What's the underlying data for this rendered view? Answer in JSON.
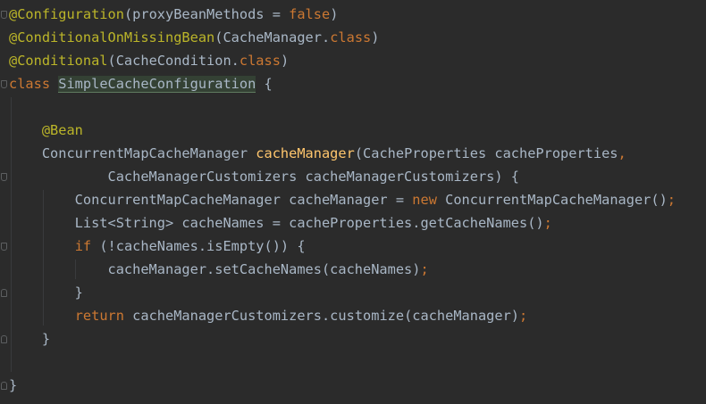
{
  "editor": {
    "lines": [
      [
        [
          "ann",
          "@Configuration"
        ],
        [
          "plain",
          "(proxyBeanMethods = "
        ],
        [
          "kw",
          "false"
        ],
        [
          "plain",
          ")"
        ]
      ],
      [
        [
          "ann",
          "@ConditionalOnMissingBean"
        ],
        [
          "plain",
          "(CacheManager."
        ],
        [
          "kw",
          "class"
        ],
        [
          "plain",
          ")"
        ]
      ],
      [
        [
          "ann",
          "@Conditional"
        ],
        [
          "plain",
          "(CacheCondition."
        ],
        [
          "kw",
          "class"
        ],
        [
          "plain",
          ")"
        ]
      ],
      [
        [
          "kw",
          "class "
        ],
        [
          "hl",
          "SimpleCacheConfiguration"
        ],
        [
          "plain",
          " {"
        ]
      ],
      [],
      [
        [
          "plain",
          "    "
        ],
        [
          "ann",
          "@Bean"
        ]
      ],
      [
        [
          "plain",
          "    ConcurrentMapCacheManager "
        ],
        [
          "fn",
          "cacheManager"
        ],
        [
          "plain",
          "(CacheProperties cacheProperties"
        ],
        [
          "punc",
          ","
        ]
      ],
      [
        [
          "plain",
          "            CacheManagerCustomizers cacheManagerCustomizers) {"
        ]
      ],
      [
        [
          "plain",
          "        ConcurrentMapCacheManager cacheManager = "
        ],
        [
          "kw",
          "new "
        ],
        [
          "plain",
          "ConcurrentMapCacheManager()"
        ],
        [
          "punc",
          ";"
        ]
      ],
      [
        [
          "plain",
          "        List<String> cacheNames = cacheProperties.getCacheNames()"
        ],
        [
          "punc",
          ";"
        ]
      ],
      [
        [
          "plain",
          "        "
        ],
        [
          "kw",
          "if "
        ],
        [
          "plain",
          "(!cacheNames.isEmpty()) {"
        ]
      ],
      [
        [
          "plain",
          "            cacheManager.setCacheNames(cacheNames)"
        ],
        [
          "punc",
          ";"
        ]
      ],
      [
        [
          "plain",
          "        }"
        ]
      ],
      [
        [
          "plain",
          "        "
        ],
        [
          "kw",
          "return "
        ],
        [
          "plain",
          "cacheManagerCustomizers.customize(cacheManager)"
        ],
        [
          "punc",
          ";"
        ]
      ],
      [
        [
          "plain",
          "    }"
        ]
      ],
      [],
      [
        [
          "plain",
          "}"
        ]
      ]
    ]
  },
  "colors": {
    "background": "#2b2b2b",
    "plain": "#a9b7c6",
    "keyword": "#cc7832",
    "annotation": "#bbb529",
    "method": "#ffc66d",
    "highlight": "#344134"
  },
  "folds": [
    {
      "line": 0,
      "kind": "open"
    },
    {
      "line": 3,
      "kind": "open"
    },
    {
      "line": 7,
      "kind": "open"
    },
    {
      "line": 10,
      "kind": "open"
    },
    {
      "line": 12,
      "kind": "close"
    },
    {
      "line": 14,
      "kind": "close"
    },
    {
      "line": 16,
      "kind": "close"
    }
  ]
}
